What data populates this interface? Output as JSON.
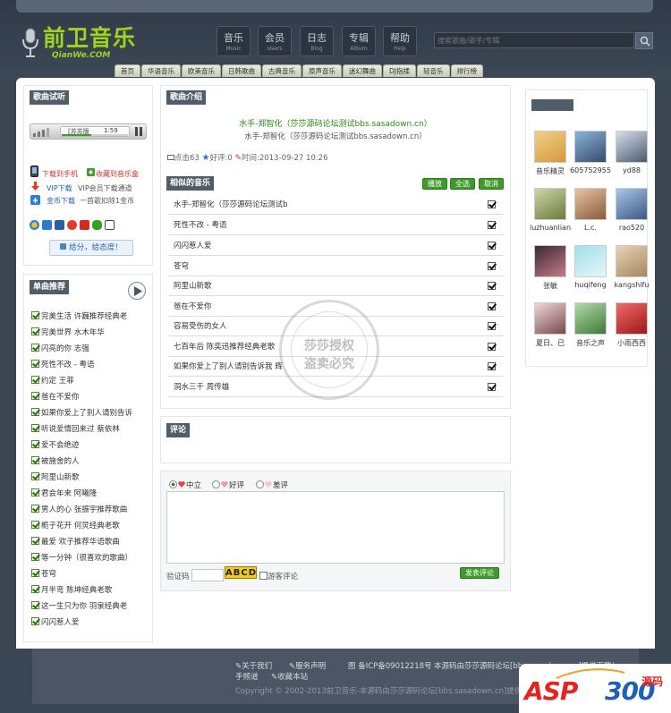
{
  "header": {
    "logo_cn": "前卫音乐",
    "logo_en": "QianWe.COM",
    "nav": [
      {
        "cn": "音乐",
        "en": "Music"
      },
      {
        "cn": "会员",
        "en": "Users"
      },
      {
        "cn": "日志",
        "en": "Blog"
      },
      {
        "cn": "专辑",
        "en": "Album"
      },
      {
        "cn": "帮助",
        "en": "Help"
      }
    ],
    "search_placeholder": "搜索歌曲/歌手/专辑",
    "subnav": [
      "首页",
      "华语音乐",
      "欧美音乐",
      "日韩歌曲",
      "古典音乐",
      "原声音乐",
      "迷幻舞曲",
      "DJ指揉",
      "轻音乐",
      "排行榜"
    ]
  },
  "trial": {
    "title": "歌曲试听",
    "player_song": "[苏苏版",
    "player_time": "1:59",
    "download_phone": "下载到手机",
    "collect": "收藏到音乐盒",
    "vip_label": "VIP下载",
    "vip_desc": "VIP会员下载通道",
    "coin_label": "金币下载",
    "coin_desc": "一首歌扣除1金币",
    "rate_button": "给分，给态度！"
  },
  "recommend": {
    "title": "单曲推荐",
    "items": [
      "完美生活 许巍推荐经典老",
      "完美世界 水木年华",
      "闪亮的你 志强",
      "死性不改 - 粤语",
      "约定 王菲",
      "爸在不爱你",
      "如果你爱上了别人请别告诉",
      "听说爱情回来过 蔡依林",
      "爱不会绝迹",
      "被施舍的人",
      "阿里山新歌",
      "君会年来 阿曦隆",
      "男人的心 张振宇推荐歌曲",
      "栀子花开 何炅经典老歌",
      "最爱 欢子推荐华语歌曲",
      "等一分钟（很喜欢的歌曲）",
      "苍穹",
      "月半弯 陈坤经典老歌",
      "这一生只为你 羽泉经典老",
      "闪闪惹人爱"
    ]
  },
  "intro": {
    "title": "歌曲介绍",
    "song_title": "水手-郑智化（莎莎源码论坛测试bbs.sasadown.cn）",
    "song_sub": "水手-郑智化（莎莎源码论坛测试bbs.sasadown.cn）",
    "clicks": "点击63",
    "likes": "好评:0",
    "time": "时间:2013-09-27 10:26"
  },
  "similar": {
    "title": "相似的音乐",
    "buttons": [
      "播放",
      "全选",
      "取消"
    ],
    "songs": [
      "水手-郑智化（莎莎源码论坛测试b",
      "死性不改 - 粤语",
      "闪闪惹人爱",
      "苍穹",
      "阿里山新歌",
      "爸在不爱你",
      "容易受伤的女人",
      "七百年后 陈奕迅推荐经典老歌",
      "如果你爱上了别人请别告诉我 辉",
      "洞水三千 周传雄"
    ]
  },
  "comment": {
    "title": "评论",
    "opt_neutral": "中立",
    "opt_good": "好评",
    "opt_bad": "差评",
    "captcha_label": "验证码",
    "captcha": "ABCD",
    "guest": "游客评论",
    "submit": "发表评论"
  },
  "watermark": {
    "line1": "莎莎授权",
    "line2": "盗卖必究"
  },
  "users": [
    "音乐精灵",
    "605752955",
    "yd88",
    "luzhuanliang",
    "L.c.",
    "rao520",
    "张敏",
    "huqifeng",
    "kangshifu",
    "夏日、已",
    "音乐之声",
    "小雨西西"
  ],
  "footer": {
    "links": [
      "关于我们",
      "服务声明",
      "手频道",
      "收藏本站"
    ],
    "icp": "图 备ICP备09012218号",
    "note": "本源码由莎莎源码论坛[bbs.sasadown.cn]提供下载！",
    "copyright": "Copyright © 2002-2013前卫音乐-本源码由莎莎源码论坛[bbs.sasadown.cn]提供"
  },
  "badge": {
    "brand_a": "ASP",
    "brand_b": "300",
    "brand_c": "源码"
  },
  "colors": {
    "accent_green": "#3f9a2a",
    "header_dark": "#525d6a",
    "logo_green": "#9fd12c"
  }
}
